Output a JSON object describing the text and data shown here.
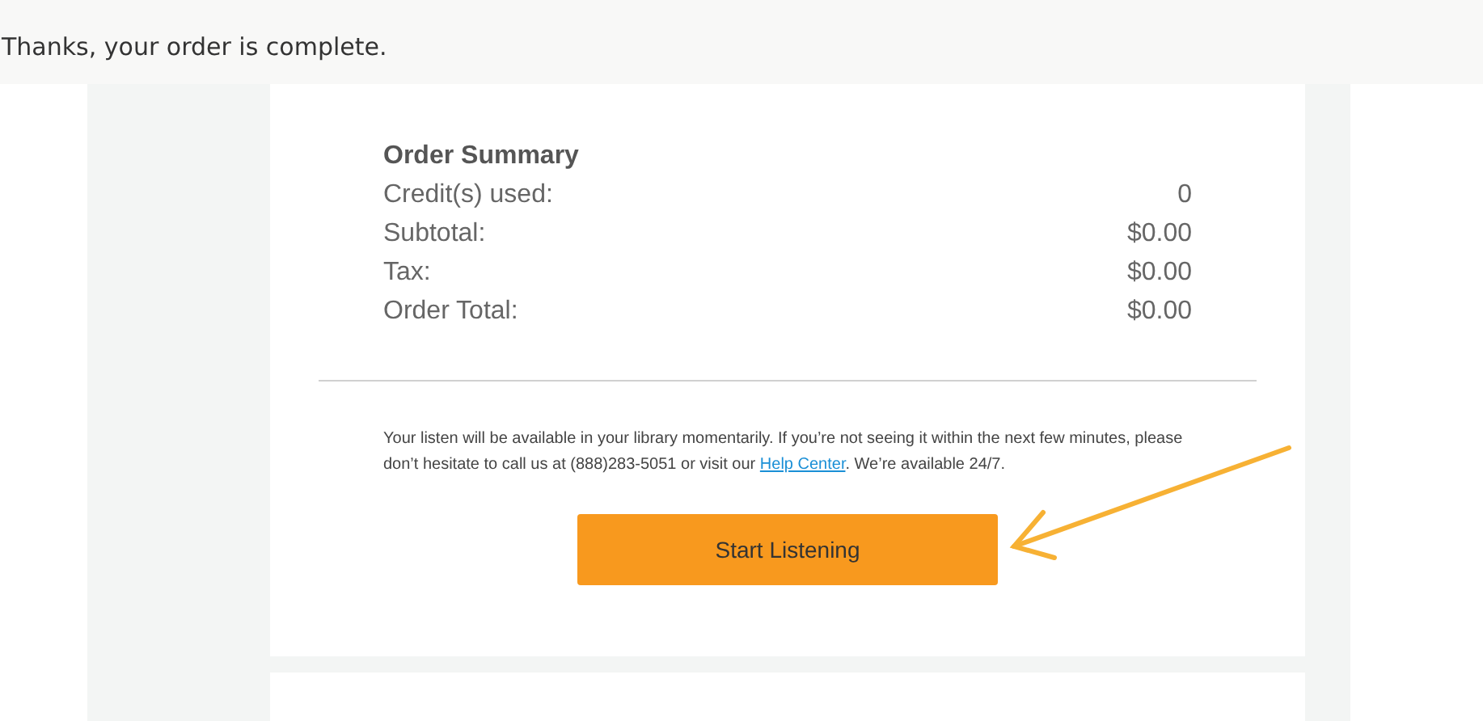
{
  "header": {
    "message": "Thanks, your order is complete."
  },
  "order_summary": {
    "title": "Order Summary",
    "rows": [
      {
        "label": "Credit(s) used:",
        "value": "0"
      },
      {
        "label": "Subtotal:",
        "value": "$0.00"
      },
      {
        "label": "Tax:",
        "value": "$0.00"
      },
      {
        "label": "Order Total:",
        "value": "$0.00"
      }
    ]
  },
  "note": {
    "before": "Your listen will be available in your library momentarily. If you’re not seeing it within the next few minutes, please don’t hesitate to call us at (888)283-5051 or visit our ",
    "link": "Help Center",
    "after": ". We’re available 24/7."
  },
  "button": {
    "label": "Start Listening"
  }
}
